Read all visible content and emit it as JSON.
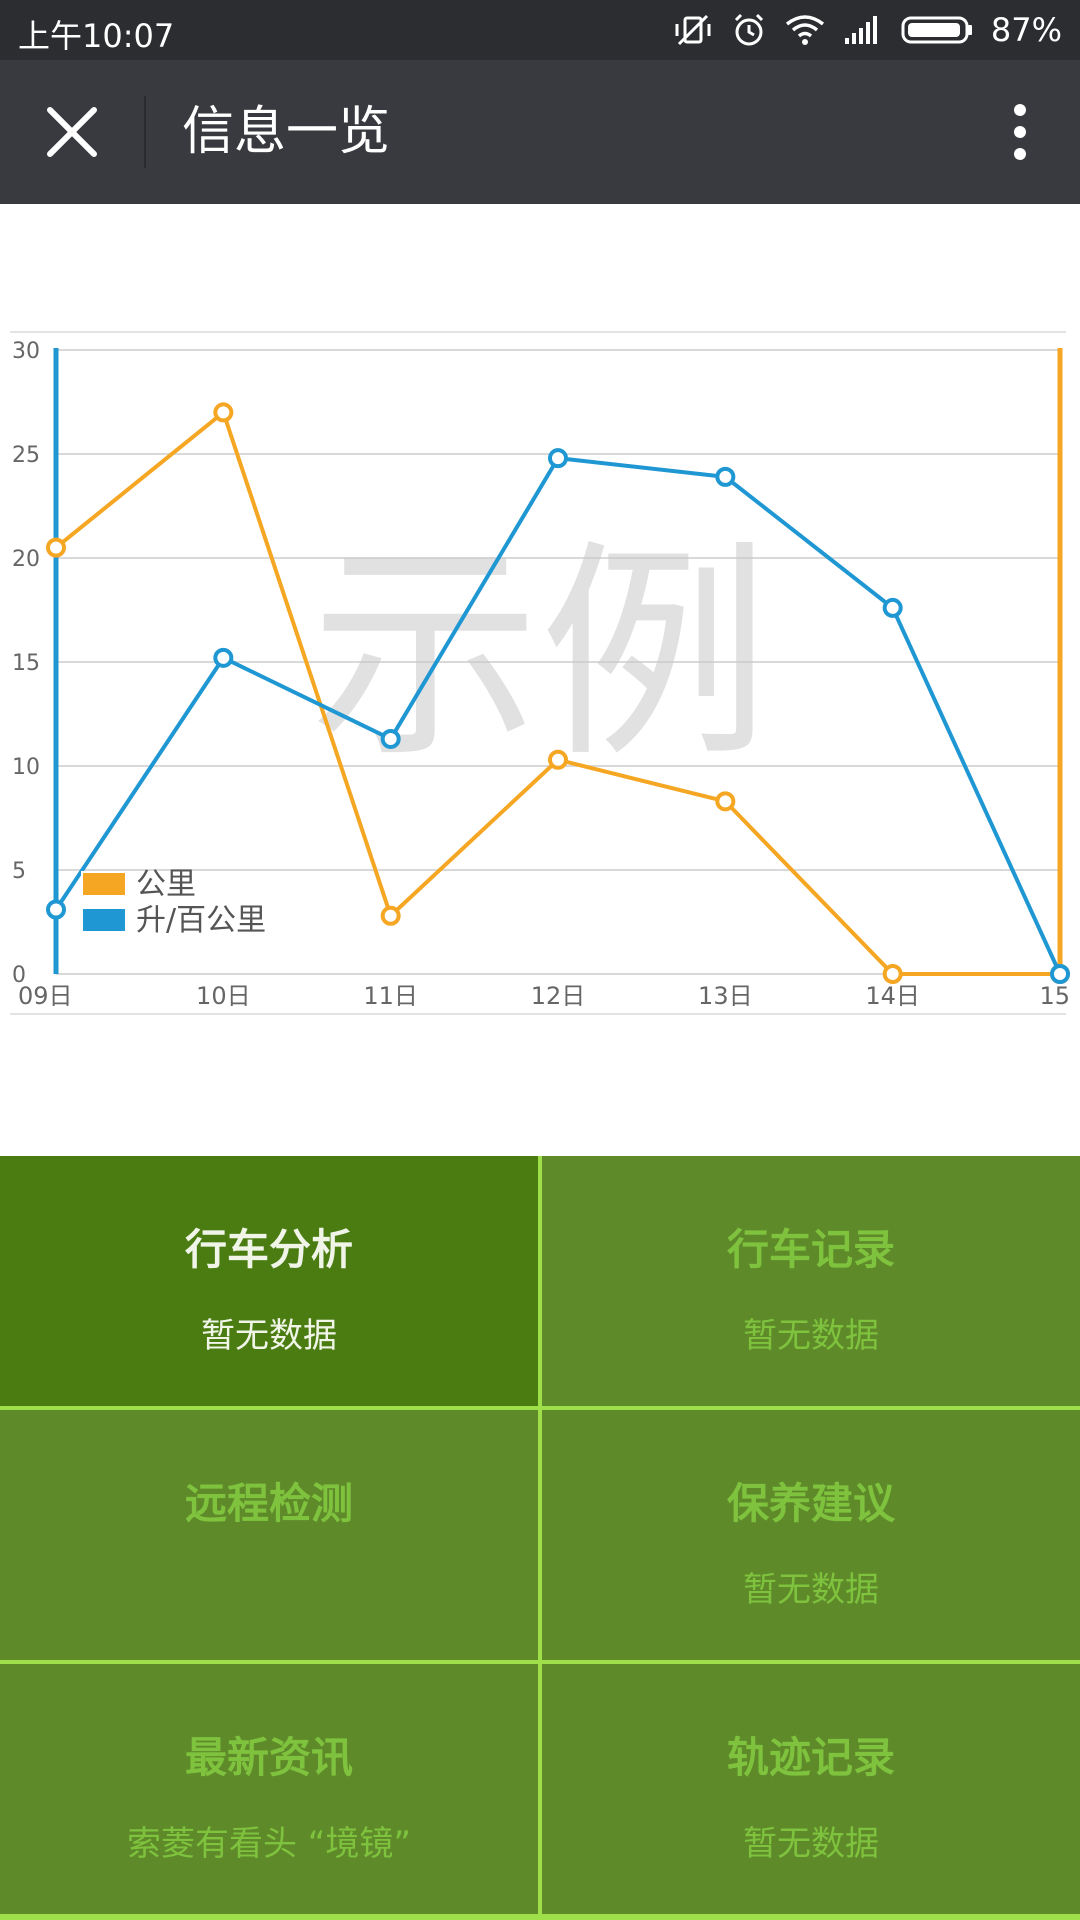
{
  "status_bar": {
    "time": "上午10:07",
    "battery": "87%",
    "icons": [
      "vibrate-off-icon",
      "alarm-icon",
      "wifi-icon",
      "signal-icon",
      "battery-icon"
    ]
  },
  "nav": {
    "title": "信息一览",
    "close_icon": "close-icon",
    "more_icon": "more-vertical-icon"
  },
  "chart_data": {
    "type": "line",
    "watermark": "示例",
    "categories": [
      "09日",
      "10日",
      "11日",
      "12日",
      "13日",
      "14日",
      "15"
    ],
    "ylim": [
      0,
      30
    ],
    "yticks": [
      "0",
      "5",
      "10",
      "15",
      "20",
      "25",
      "30"
    ],
    "series": [
      {
        "name": "公里",
        "color": "#f5a623",
        "values": [
          20.5,
          27,
          2.8,
          10.3,
          8.3,
          0,
          0
        ]
      },
      {
        "name": "升/百公里",
        "color": "#1f97d3",
        "values": [
          3.1,
          15.2,
          11.3,
          24.8,
          23.9,
          17.6,
          0
        ]
      }
    ],
    "legend": "bottom-left",
    "grid": true
  },
  "cards": [
    {
      "title": "行车分析",
      "sub": "暂无数据",
      "active": true
    },
    {
      "title": "行车记录",
      "sub": "暂无数据",
      "active": false
    },
    {
      "title": "远程检测",
      "sub": "",
      "active": false
    },
    {
      "title": "保养建议",
      "sub": "暂无数据",
      "active": false
    },
    {
      "title": "最新资讯",
      "sub": "索菱有看头 “境镜”",
      "active": false
    },
    {
      "title": "轨迹记录",
      "sub": "暂无数据",
      "active": false
    }
  ],
  "colors": {
    "statusbar": "#2b2d31",
    "navbar": "#393a3f",
    "card": "#5e8a2a",
    "card_active": "#4a7c11",
    "card_text": "#7ec23e",
    "grid_line": "#9fe04a"
  }
}
